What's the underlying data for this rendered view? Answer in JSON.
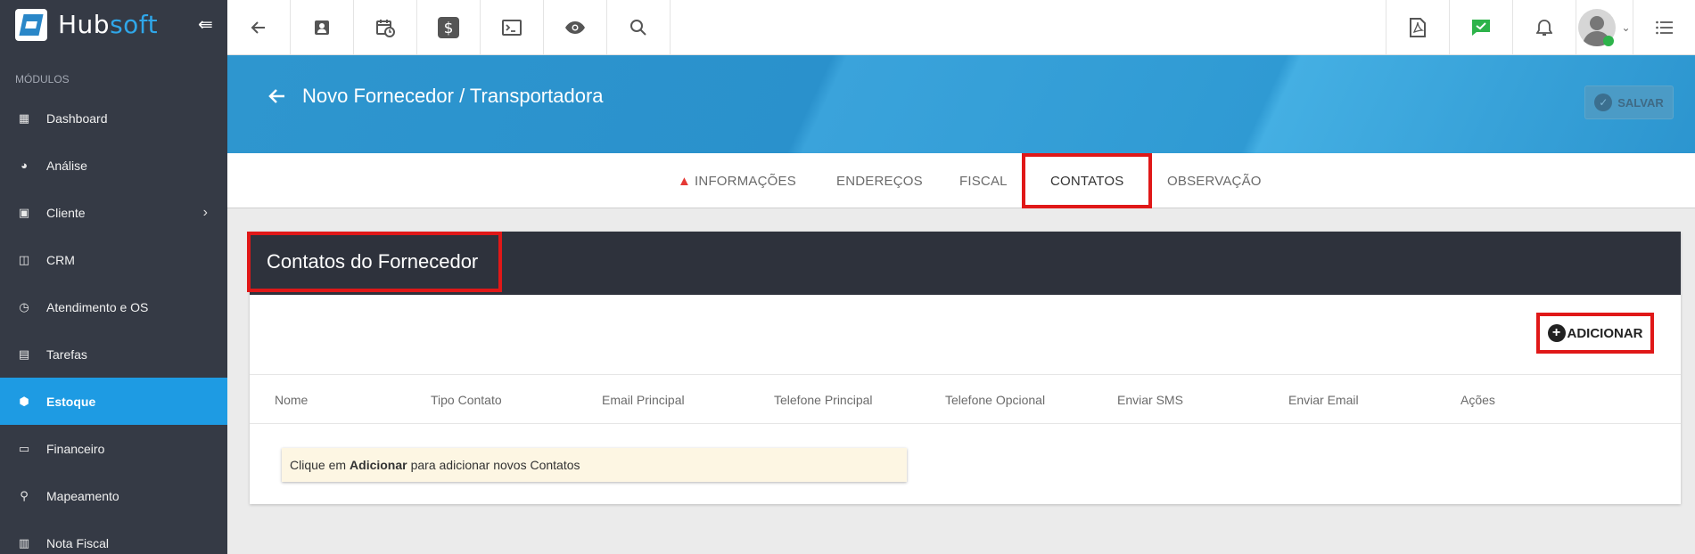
{
  "brand": {
    "name_part1": "Hub",
    "name_part2": "soft"
  },
  "sidebar": {
    "section_label": "MÓDULOS",
    "items": [
      {
        "label": "Dashboard",
        "icon": "grid-icon"
      },
      {
        "label": "Análise",
        "icon": "pie-chart-icon"
      },
      {
        "label": "Cliente",
        "icon": "contact-card-icon",
        "has_submenu": true
      },
      {
        "label": "CRM",
        "icon": "kanban-icon"
      },
      {
        "label": "Atendimento e OS",
        "icon": "calendar-clock-icon"
      },
      {
        "label": "Tarefas",
        "icon": "briefcase-icon"
      },
      {
        "label": "Estoque",
        "icon": "box-icon",
        "active": true
      },
      {
        "label": "Financeiro",
        "icon": "money-icon"
      },
      {
        "label": "Mapeamento",
        "icon": "map-pin-icon"
      },
      {
        "label": "Nota Fiscal",
        "icon": "receipt-icon"
      }
    ]
  },
  "topbar": {
    "left_icons": [
      "back-arrow-icon",
      "contact-card-icon",
      "calendar-clock-icon",
      "dollar-icon",
      "terminal-icon",
      "eye-icon",
      "search-icon"
    ],
    "right_icons": [
      "pdf-icon",
      "chat-check-icon",
      "bell-icon",
      "avatar",
      "list-icon"
    ]
  },
  "header": {
    "title": "Novo Fornecedor / Transportadora",
    "save_label": "SALVAR"
  },
  "tabs": [
    {
      "label": "INFORMAÇÕES",
      "warning": true
    },
    {
      "label": "ENDEREÇOS"
    },
    {
      "label": "FISCAL"
    },
    {
      "label": "CONTATOS",
      "active": true
    },
    {
      "label": "OBSERVAÇÃO"
    }
  ],
  "card": {
    "title": "Contatos do Fornecedor",
    "add_label": "ADICIONAR",
    "columns": [
      "Nome",
      "Tipo Contato",
      "Email Principal",
      "Telefone Principal",
      "Telefone Opcional",
      "Enviar SMS",
      "Enviar Email",
      "Ações"
    ],
    "empty_message": {
      "prefix": "Clique em",
      "bold": "Adicionar",
      "suffix": "para adicionar novos Contatos"
    }
  },
  "colors": {
    "sidebar_bg": "#353a45",
    "active_item": "#1e9be3",
    "header_band": "#2e96cf",
    "highlight_border": "#e01818",
    "card_header": "#2e323c"
  }
}
